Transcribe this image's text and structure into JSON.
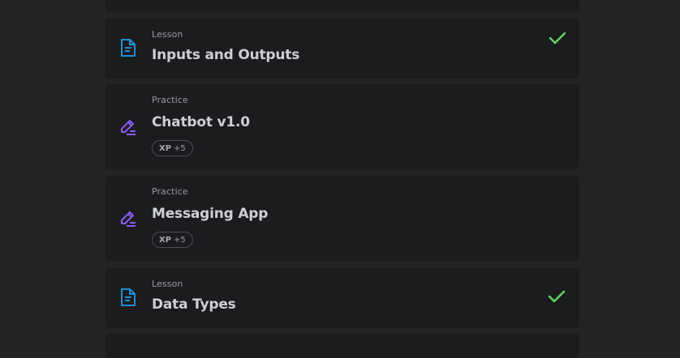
{
  "items": [
    {
      "kind": "Lesson",
      "title": "Inputs and Outputs",
      "icon": "lesson-document-icon",
      "completed": true
    },
    {
      "kind": "Practice",
      "title": "Chatbot v1.0",
      "icon": "practice-pencil-icon",
      "xp_label": "XP",
      "xp_value": "+5"
    },
    {
      "kind": "Practice",
      "title": "Messaging App",
      "icon": "practice-pencil-icon",
      "xp_label": "XP",
      "xp_value": "+5"
    },
    {
      "kind": "Lesson",
      "title": "Data Types",
      "icon": "lesson-document-icon",
      "completed": true
    }
  ],
  "colors": {
    "background": "#232425",
    "card": "#1b1c1e",
    "lesson_icon": "#1e8fd6",
    "practice_icon": "#8b5cf6",
    "check": "#5fd35f"
  }
}
